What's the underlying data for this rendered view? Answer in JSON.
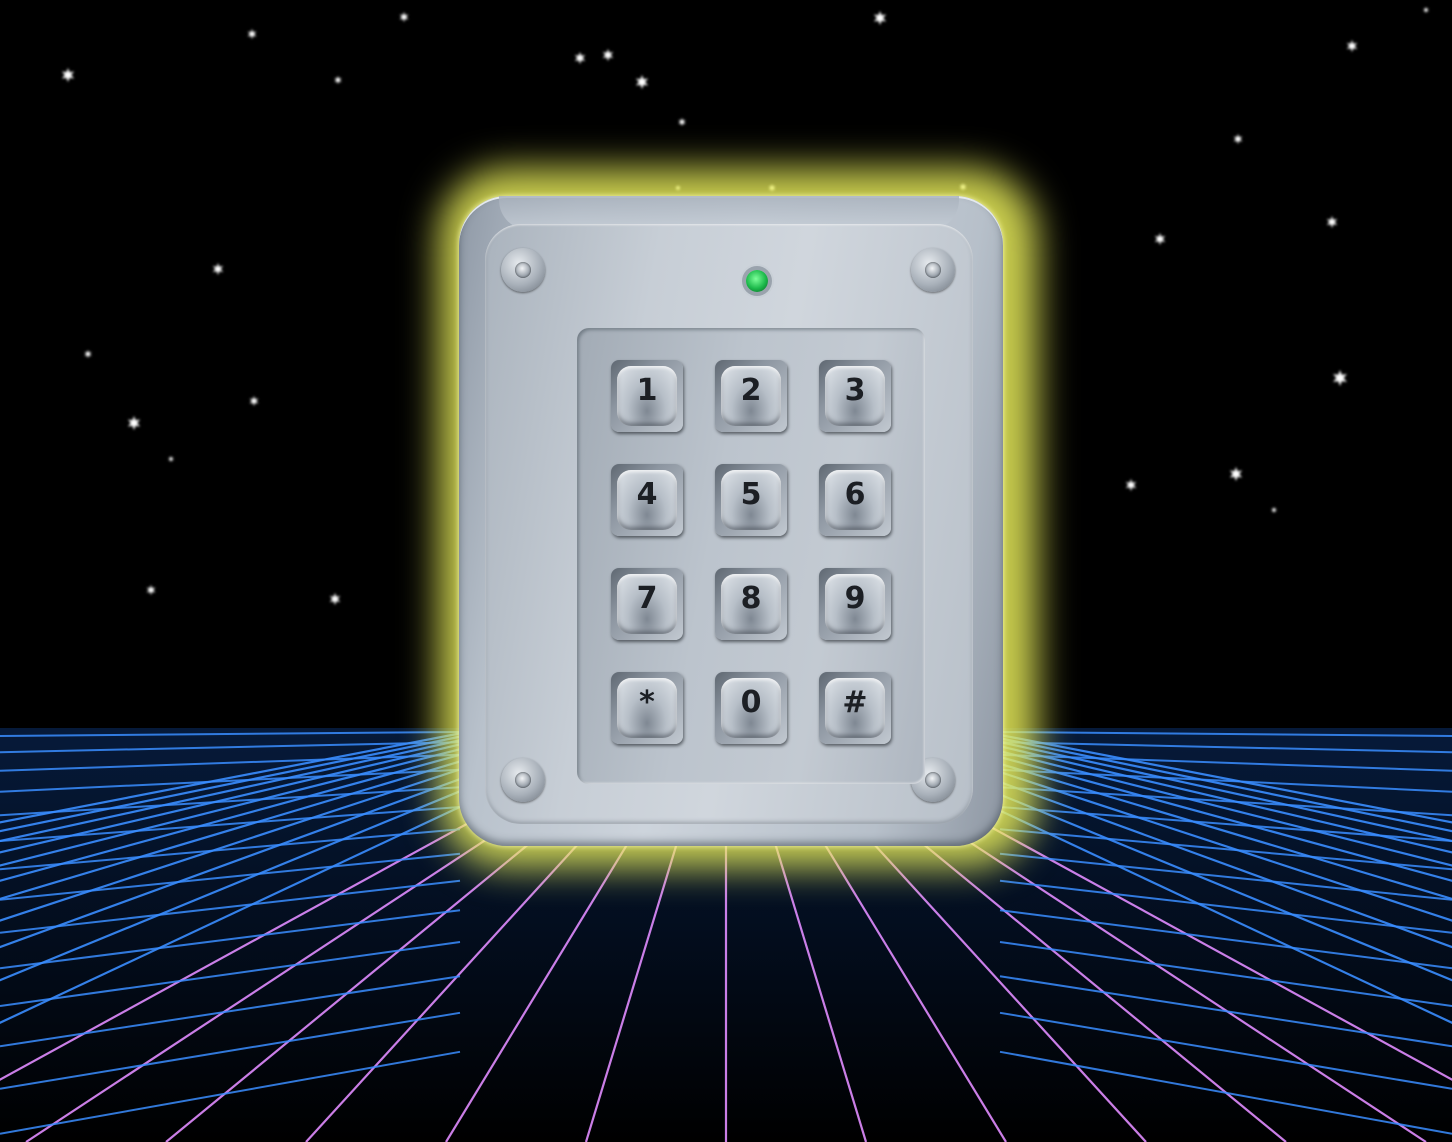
{
  "image": {
    "subject": "keypad-on-starfield",
    "colors": {
      "sky": "#000000",
      "star": "#ffffff",
      "grid_line_blue": "#3a8dff",
      "grid_line_pink": "#e08cff",
      "glow": "#e6f04c",
      "led": "#22c55e",
      "metal": "#c3cad2"
    }
  },
  "keypad": {
    "status_led": "green",
    "keys": [
      {
        "label": "1"
      },
      {
        "label": "2"
      },
      {
        "label": "3"
      },
      {
        "label": "4"
      },
      {
        "label": "5"
      },
      {
        "label": "6"
      },
      {
        "label": "7"
      },
      {
        "label": "8"
      },
      {
        "label": "9"
      },
      {
        "label": "*"
      },
      {
        "label": "0"
      },
      {
        "label": "#"
      }
    ]
  }
}
